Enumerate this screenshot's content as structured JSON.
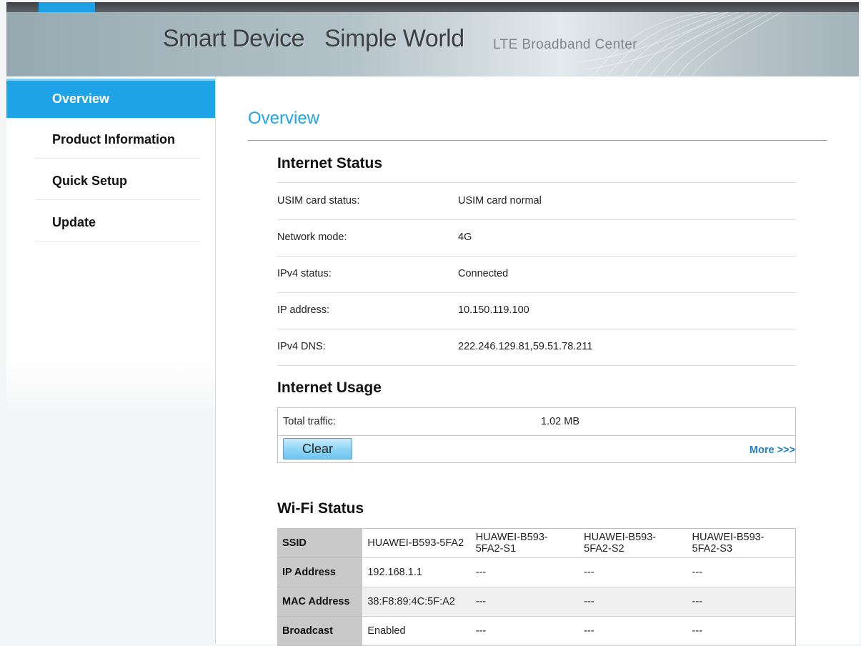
{
  "header": {
    "slogan": [
      "Smart Device",
      "Simple World"
    ],
    "product_name": "LTE  Broadband  Center"
  },
  "sidebar": {
    "items": [
      {
        "label": "Overview",
        "active": true
      },
      {
        "label": "Product Information",
        "active": false
      },
      {
        "label": "Quick Setup",
        "active": false
      },
      {
        "label": "Update",
        "active": false
      }
    ]
  },
  "main": {
    "title": "Overview",
    "internet_status": {
      "title": "Internet Status",
      "rows": [
        {
          "label": "USIM card status:",
          "value": "USIM card normal"
        },
        {
          "label": "Network mode:",
          "value": "4G"
        },
        {
          "label": "IPv4 status:",
          "value": "Connected"
        },
        {
          "label": "IP address:",
          "value": "10.150.119.100"
        },
        {
          "label": "IPv4 DNS:",
          "value": "222.246.129.81,59.51.78.211"
        }
      ]
    },
    "internet_usage": {
      "title": "Internet Usage",
      "total_label": "Total traffic:",
      "total_value": "1.02 MB",
      "clear_label": "Clear",
      "more_label": "More >>>"
    },
    "wifi_status": {
      "title": "Wi-Fi Status",
      "rows": [
        {
          "label": "SSID",
          "values": [
            "HUAWEI-B593-5FA2",
            "HUAWEI-B593-5FA2-S1",
            "HUAWEI-B593-5FA2-S2",
            "HUAWEI-B593-5FA2-S3"
          ]
        },
        {
          "label": "IP Address",
          "values": [
            "192.168.1.1",
            "---",
            "---",
            "---"
          ]
        },
        {
          "label": "MAC Address",
          "values": [
            "38:F8:89:4C:5F:A2",
            "---",
            "---",
            "---"
          ]
        },
        {
          "label": "Broadcast",
          "values": [
            "Enabled",
            "---",
            "---",
            "---"
          ]
        }
      ]
    }
  },
  "colors": {
    "accent": "#1ea4e6",
    "link": "#1f7fc0"
  }
}
